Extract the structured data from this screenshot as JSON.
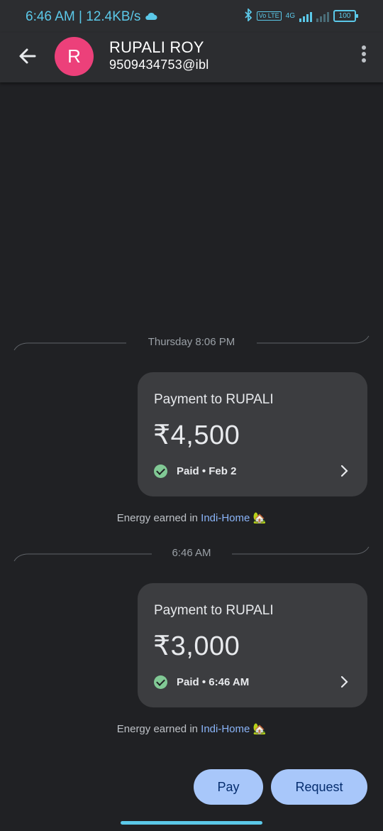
{
  "status_bar": {
    "time": "6:46 AM",
    "net_speed": "12.4KB/s",
    "network": "4G",
    "volte": "Vo LTE",
    "battery": "100"
  },
  "contact": {
    "avatar_letter": "R",
    "name": "RUPALI ROY",
    "upi_id": "9509434753@ibl"
  },
  "messages": [
    {
      "date_label": "Thursday 8:06 PM",
      "card_title": "Payment to RUPALI",
      "amount": "₹4,500",
      "status": "Paid • Feb 2",
      "energy_prefix": "Energy earned in",
      "energy_link": "Indi-Home",
      "energy_emoji": "🏡"
    },
    {
      "date_label": "6:46 AM",
      "card_title": "Payment to RUPALI",
      "amount": "₹3,000",
      "status": "Paid • 6:46 AM",
      "energy_prefix": "Energy earned in",
      "energy_link": "Indi-Home",
      "energy_emoji": "🏡"
    }
  ],
  "actions": {
    "pay_label": "Pay",
    "request_label": "Request"
  },
  "colors": {
    "background": "#202124",
    "app_bar": "#2c2d30",
    "card": "#3c3d40",
    "avatar": "#ec407a",
    "accent_link": "#8ab4f8",
    "button": "#a8c7fa",
    "success": "#81c995",
    "status_bar_text": "#5bc8e8"
  },
  "icons": [
    "back-arrow-icon",
    "more-vert-icon",
    "check-circle-icon",
    "chevron-right-icon",
    "cloud-icon",
    "bluetooth-icon",
    "signal-icon",
    "battery-icon"
  ]
}
